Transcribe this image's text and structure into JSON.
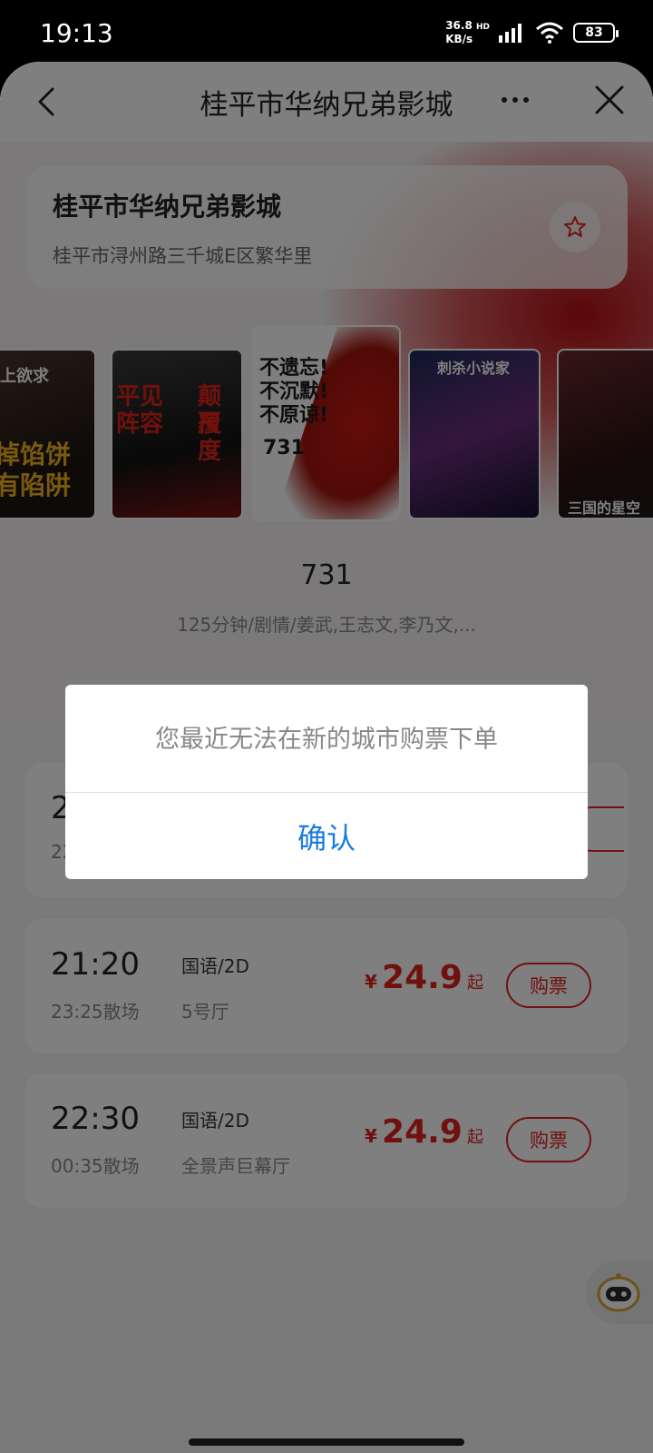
{
  "status_bar": {
    "time": "19:13",
    "net_speed_value": "36.8",
    "net_speed_unit": "KB/s",
    "net_type": "HD",
    "battery": "83"
  },
  "header": {
    "title": "桂平市华纳兄弟影城"
  },
  "cinema": {
    "name": "桂平市华纳兄弟影城",
    "address": "桂平市浔州路三千城E区繁华里"
  },
  "posters": [
    {
      "lines": [
        "上掉馅饼",
        "上有陷阱"
      ],
      "top_text": "天上欲求"
    },
    {
      "lines": [
        "平见",
        "阵容"
      ],
      "side": [
        "颠覆",
        "尺度"
      ]
    },
    {
      "lines": [
        "不遗忘!",
        "不沉默!",
        "不原谅!"
      ],
      "number": "731"
    },
    {
      "title": "刺杀小说家"
    },
    {
      "title": "三国的星空"
    }
  ],
  "movie": {
    "title": "731",
    "info": "125分钟/剧情/姜武,王志文,李乃文,..."
  },
  "showtimes": [
    {
      "start": "2",
      "end": "22",
      "lang": "",
      "hall": "",
      "price_symbol": "¥",
      "price": "",
      "price_suffix": "",
      "buy": ""
    },
    {
      "start": "21:20",
      "end": "23:25散场",
      "lang": "国语/2D",
      "hall": "5号厅",
      "price_symbol": "¥",
      "price": "24.9",
      "price_suffix": "起",
      "buy": "购票"
    },
    {
      "start": "22:30",
      "end": "00:35散场",
      "lang": "国语/2D",
      "hall": "全景声巨幕厅",
      "price_symbol": "¥",
      "price": "24.9",
      "price_suffix": "起",
      "buy": "购票"
    }
  ],
  "dialog": {
    "message": "您最近无法在新的城市购票下单",
    "confirm": "确认"
  },
  "colors": {
    "accent_red": "#e0231d",
    "link_blue": "#1a7be0"
  },
  "icons": [
    "back-icon",
    "more-icon",
    "close-icon",
    "star-icon",
    "robot-icon",
    "wifi-icon",
    "signal-icon",
    "battery-icon"
  ]
}
